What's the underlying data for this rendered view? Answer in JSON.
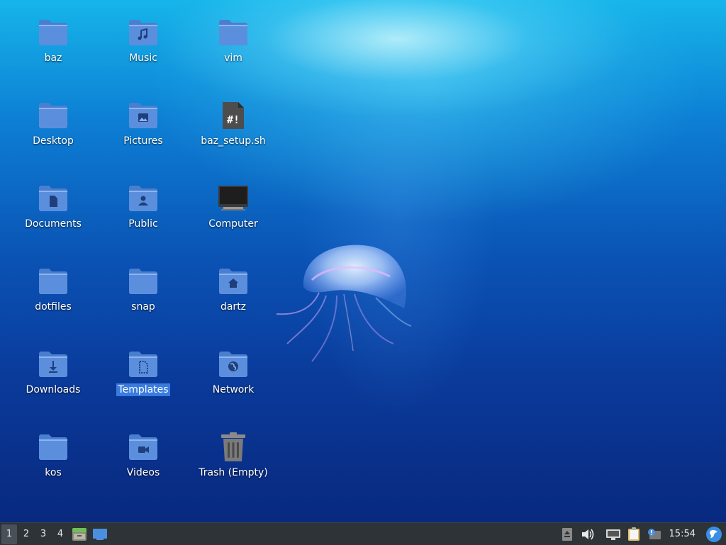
{
  "desktop": {
    "icons": [
      {
        "label": "baz",
        "type": "folder",
        "emblem": "none"
      },
      {
        "label": "Music",
        "type": "folder",
        "emblem": "music"
      },
      {
        "label": "vim",
        "type": "folder",
        "emblem": "none"
      },
      {
        "label": "Desktop",
        "type": "folder",
        "emblem": "none"
      },
      {
        "label": "Pictures",
        "type": "folder",
        "emblem": "picture"
      },
      {
        "label": "baz_setup.sh",
        "type": "script",
        "emblem": "#!"
      },
      {
        "label": "Documents",
        "type": "folder",
        "emblem": "document"
      },
      {
        "label": "Public",
        "type": "folder",
        "emblem": "user"
      },
      {
        "label": "Computer",
        "type": "computer",
        "emblem": "monitor"
      },
      {
        "label": "dotfiles",
        "type": "folder",
        "emblem": "none"
      },
      {
        "label": "snap",
        "type": "folder",
        "emblem": "none"
      },
      {
        "label": "dartz",
        "type": "folder",
        "emblem": "home"
      },
      {
        "label": "Downloads",
        "type": "folder",
        "emblem": "download"
      },
      {
        "label": "Templates",
        "type": "folder",
        "emblem": "template",
        "selected": true
      },
      {
        "label": "Network",
        "type": "folder",
        "emblem": "globe"
      },
      {
        "label": "kos",
        "type": "folder",
        "emblem": "none"
      },
      {
        "label": "Videos",
        "type": "folder",
        "emblem": "video"
      },
      {
        "label": "Trash (Empty)",
        "type": "trash",
        "emblem": "trash"
      }
    ]
  },
  "taskbar": {
    "workspaces": [
      "1",
      "2",
      "3",
      "4"
    ],
    "active_workspace": "1",
    "clock": "15:54"
  },
  "colors": {
    "folder": "#5b8fdd",
    "folder_tab": "#4a7fd0",
    "emblem": "#1e3f7c",
    "selection": "#3a7be0",
    "taskbar": "#2e3338"
  }
}
